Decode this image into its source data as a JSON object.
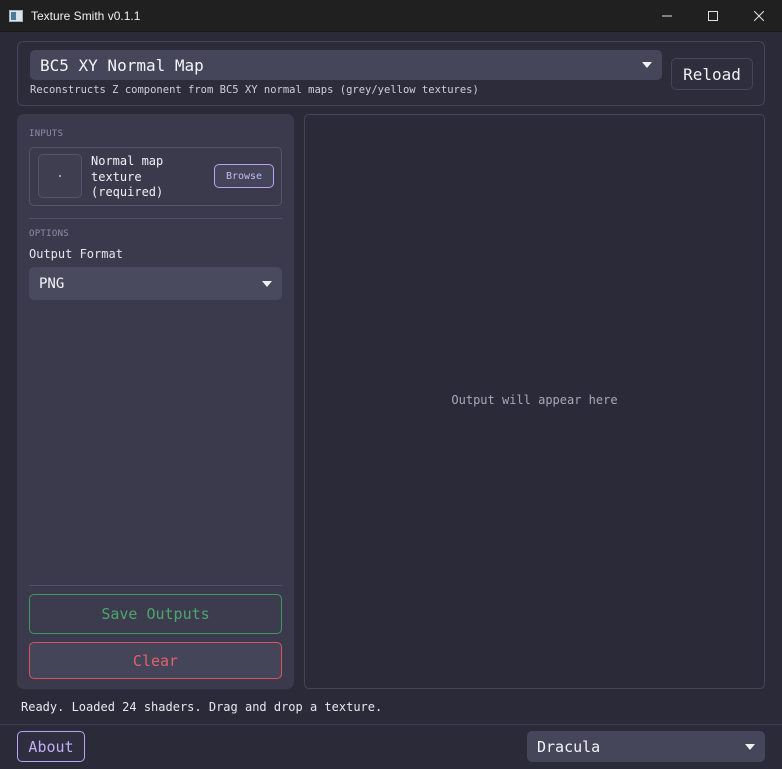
{
  "window": {
    "title": "Texture Smith v0.1.1"
  },
  "header": {
    "shader_selected": "BC5 XY Normal Map",
    "reload_label": "Reload",
    "description": "Reconstructs Z component from BC5 XY normal maps (grey/yellow textures)"
  },
  "inputs": {
    "section_label": "INPUTS",
    "items": [
      {
        "label": "Normal map texture (required)",
        "button_label": "Browse"
      }
    ]
  },
  "options": {
    "section_label": "OPTIONS",
    "output_format_label": "Output Format",
    "output_format_value": "PNG"
  },
  "actions": {
    "save_label": "Save Outputs",
    "clear_label": "Clear"
  },
  "output": {
    "placeholder": "Output will appear here"
  },
  "status": {
    "text": "Ready. Loaded 24 shaders. Drag and drop a texture."
  },
  "footer": {
    "about_label": "About",
    "theme_value": "Dracula"
  },
  "colors": {
    "accent_purple": "#bd93f9",
    "save_green": "#50a46c",
    "clear_red": "#e0616b",
    "background": "#2a2a38"
  }
}
